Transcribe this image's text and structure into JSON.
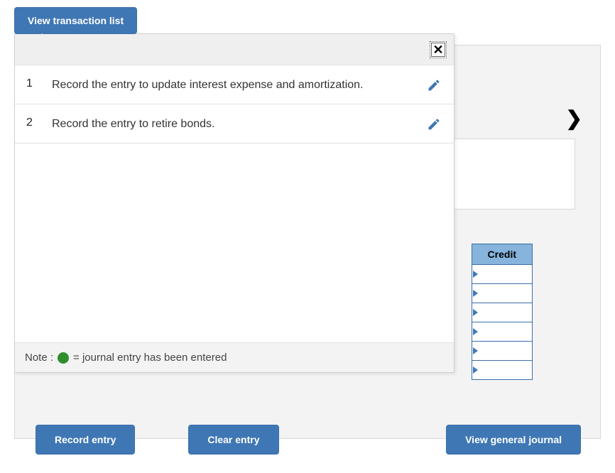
{
  "top_button": {
    "label": "View transaction list"
  },
  "popup": {
    "close_glyph": "✕",
    "transactions": [
      {
        "num": "1",
        "text": "Record the entry to update interest expense and amortization."
      },
      {
        "num": "2",
        "text": "Record the entry to retire bonds."
      }
    ],
    "note_prefix": "Note :",
    "note_suffix": "= journal entry has been entered"
  },
  "journal": {
    "credit_header": "Credit",
    "row_count": 6
  },
  "buttons": {
    "record": "Record entry",
    "clear": "Clear entry",
    "view_journal": "View general journal"
  },
  "next_glyph": "❯"
}
